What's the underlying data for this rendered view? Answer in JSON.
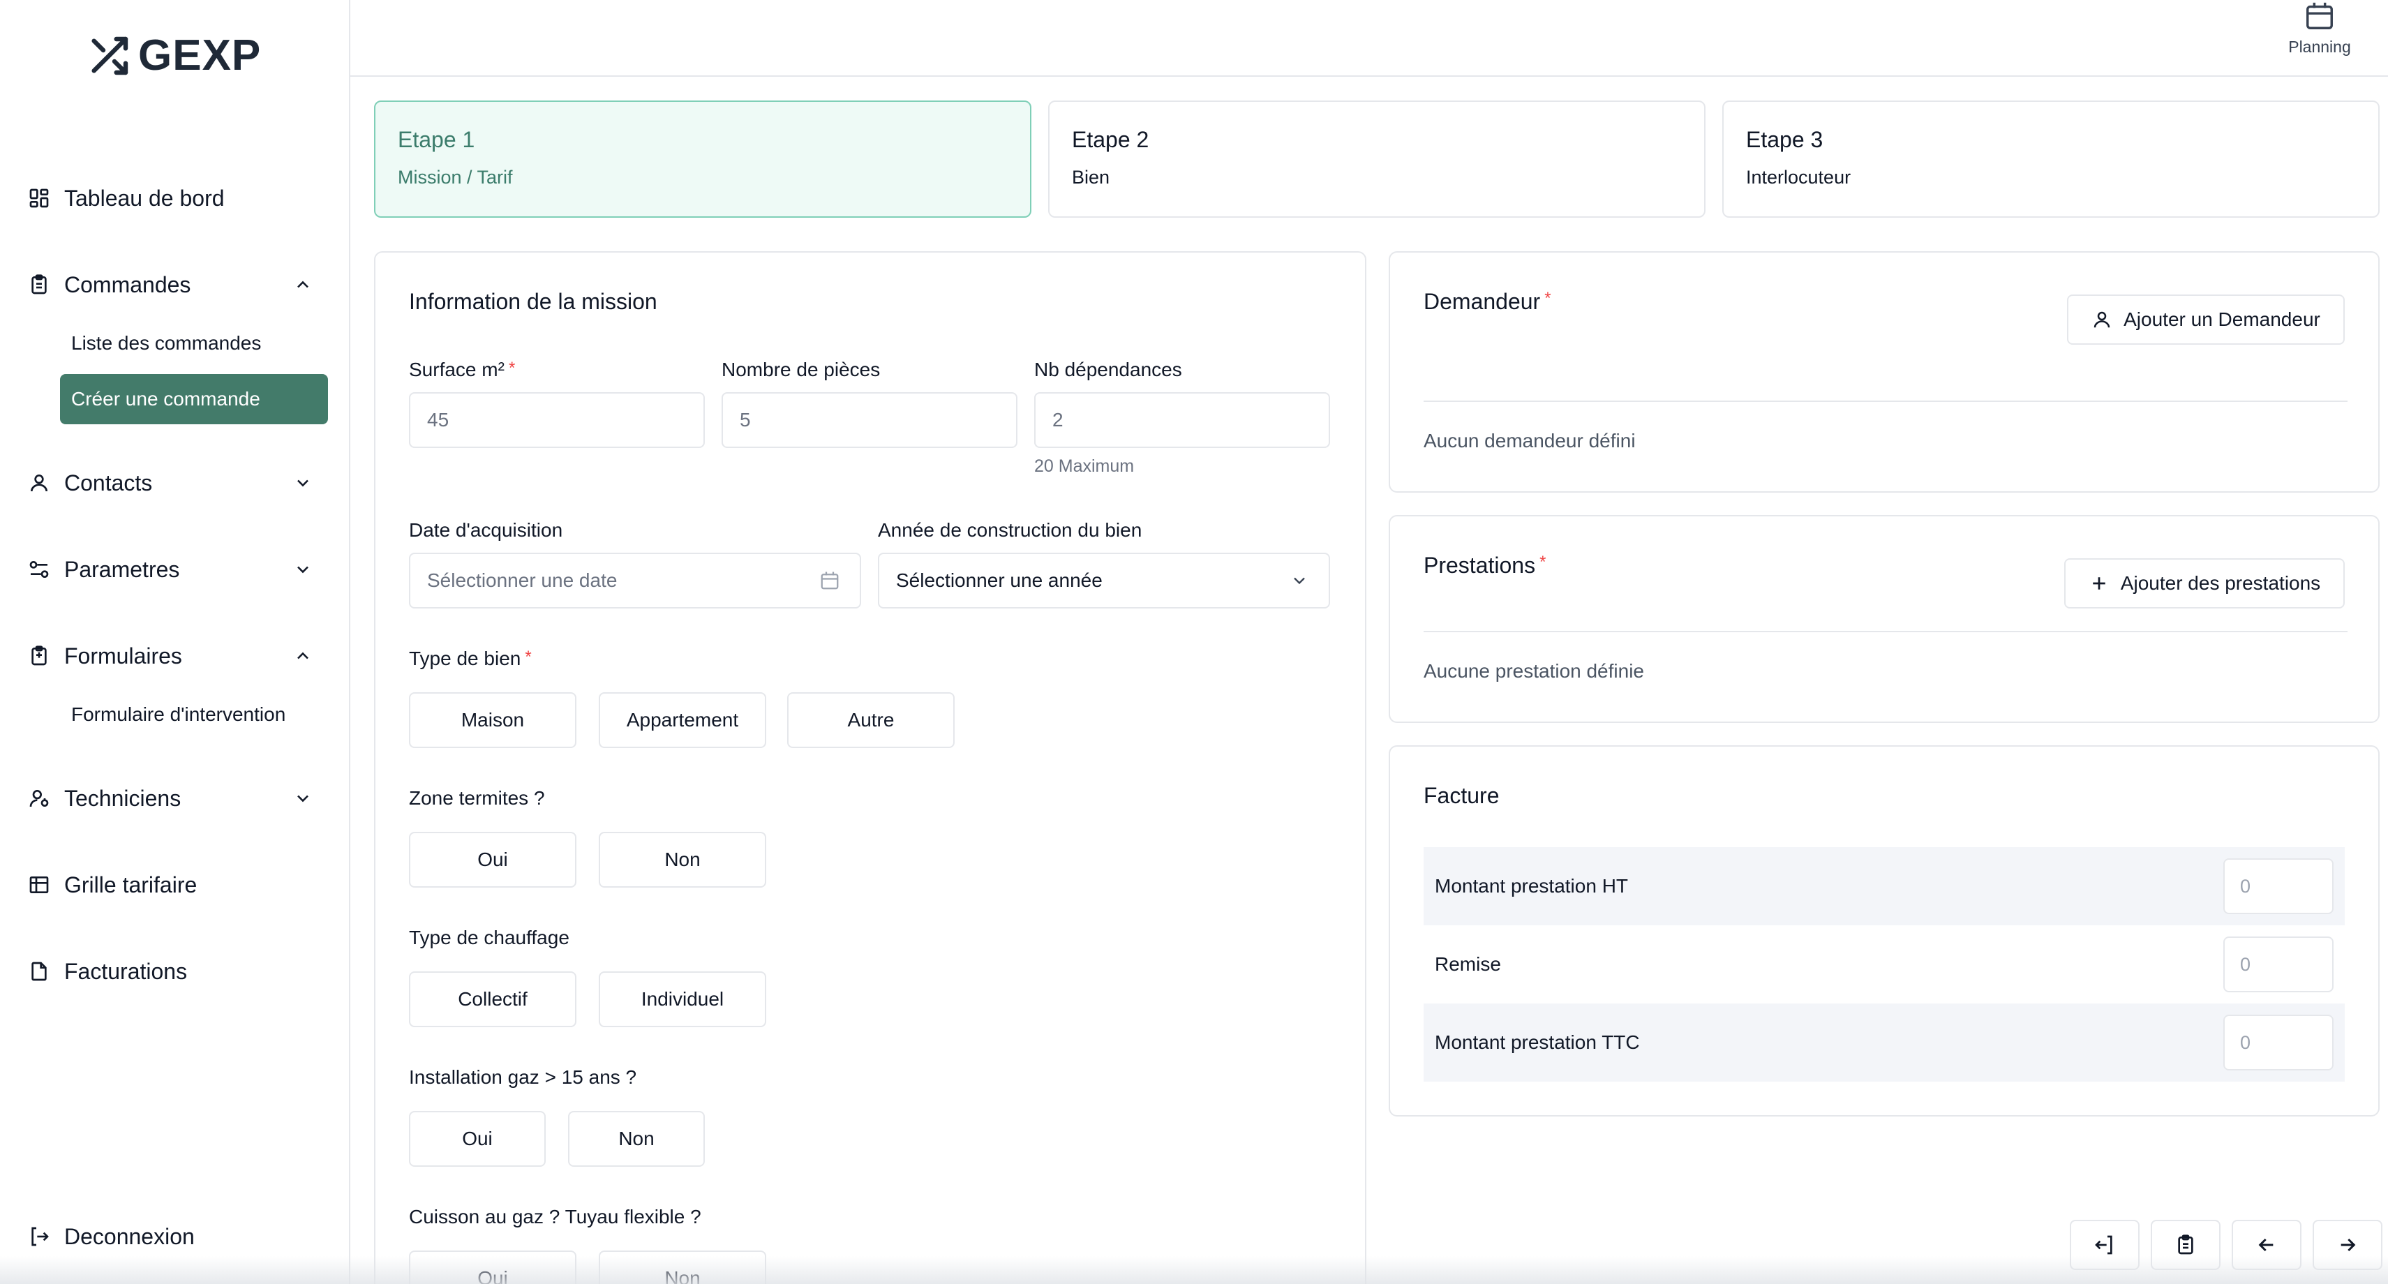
{
  "app": {
    "logo_text": "GEXP"
  },
  "topbar": {
    "planning_label": "Planning"
  },
  "sidebar": {
    "items": [
      {
        "label": "Tableau de bord",
        "icon": "dashboard-icon"
      },
      {
        "label": "Commandes",
        "icon": "clipboard-icon",
        "expanded": true,
        "children": [
          {
            "label": "Liste des commandes"
          },
          {
            "label": "Créer une commande",
            "active": true
          }
        ]
      },
      {
        "label": "Contacts",
        "icon": "user-icon",
        "expanded": false
      },
      {
        "label": "Parametres",
        "icon": "sliders-icon",
        "expanded": false
      },
      {
        "label": "Formulaires",
        "icon": "form-icon",
        "expanded": true,
        "children": [
          {
            "label": "Formulaire d'intervention"
          }
        ]
      },
      {
        "label": "Techniciens",
        "icon": "technician-icon",
        "expanded": false
      },
      {
        "label": "Grille tarifaire",
        "icon": "table-icon"
      },
      {
        "label": "Facturations",
        "icon": "file-icon"
      }
    ],
    "logout_label": "Deconnexion"
  },
  "steps": [
    {
      "title": "Etape 1",
      "subtitle": "Mission / Tarif",
      "active": true
    },
    {
      "title": "Etape 2",
      "subtitle": "Bien",
      "active": false
    },
    {
      "title": "Etape 3",
      "subtitle": "Interlocuteur",
      "active": false
    }
  ],
  "mission": {
    "title": "Information de la mission",
    "surface": {
      "label": "Surface m²",
      "value": "45"
    },
    "pieces": {
      "label": "Nombre de pièces",
      "value": "5"
    },
    "dependances": {
      "label": "Nb dépendances",
      "value": "2",
      "hint": "20 Maximum"
    },
    "acquisition": {
      "label": "Date d'acquisition",
      "placeholder": "Sélectionner une date"
    },
    "construction": {
      "label": "Année de construction du bien",
      "value": "Sélectionner une année"
    },
    "type_bien": {
      "label": "Type de bien",
      "options": [
        "Maison",
        "Appartement",
        "Autre"
      ]
    },
    "termites": {
      "label": "Zone termites ?",
      "options": [
        "Oui",
        "Non"
      ]
    },
    "chauffage": {
      "label": "Type de chauffage",
      "options": [
        "Collectif",
        "Individuel"
      ]
    },
    "gaz": {
      "label": "Installation gaz > 15 ans ?",
      "options": [
        "Oui",
        "Non"
      ]
    },
    "cuisson": {
      "label": "Cuisson au gaz ? Tuyau flexible ?",
      "options": [
        "Oui",
        "Non"
      ]
    }
  },
  "demandeur": {
    "title": "Demandeur",
    "button": "Ajouter un Demandeur",
    "empty": "Aucun demandeur défini"
  },
  "prestations": {
    "title": "Prestations",
    "button": "Ajouter des prestations",
    "empty": "Aucune prestation définie"
  },
  "facture": {
    "title": "Facture",
    "rows": [
      {
        "label": "Montant prestation HT",
        "value": "0"
      },
      {
        "label": "Remise",
        "value": "0"
      },
      {
        "label": "Montant prestation TTC",
        "value": "0"
      }
    ]
  },
  "colors": {
    "accent": "#437b6a",
    "active_step_bg": "#eefaf6",
    "required": "#ef4444"
  }
}
